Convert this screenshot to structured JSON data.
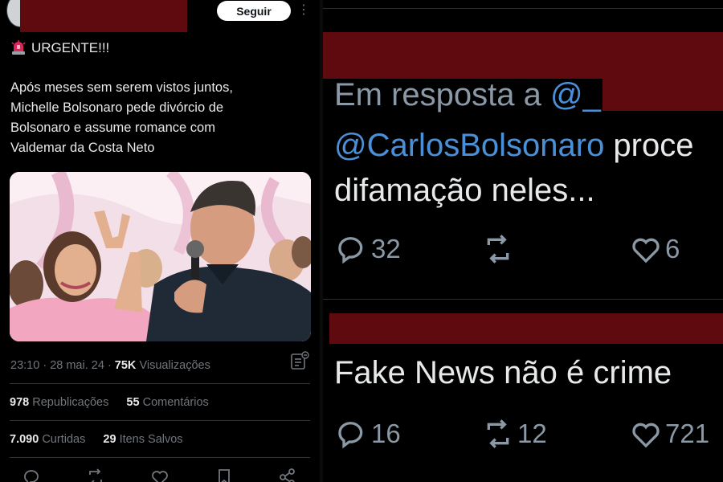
{
  "left_tweet": {
    "follow_label": "Seguir",
    "more_label": "⋮",
    "urgent": "URGENTE!!!",
    "text_lines": [
      "Após meses sem serem vistos juntos,",
      "Michelle Bolsonaro pede divórcio de",
      "Bolsonaro e assume romance com",
      "Valdemar da Costa Neto"
    ],
    "time": "23:10",
    "date": "28 mai. 24",
    "views": "75K",
    "views_label": "Visualizações",
    "reposts": "978",
    "reposts_label": "Republicações",
    "comments": "55",
    "comments_label": "Comentários",
    "likes": "7.090",
    "likes_label": "Curtidas",
    "saves": "29",
    "saves_label": "Itens Salvos"
  },
  "right_top": {
    "reply_prefix": "Em resposta a ",
    "reply_handle": "@_",
    "mention": "@CarlosBolsonaro",
    "text_rest": " proce",
    "text_line2": "difamação neles...",
    "replies": "32",
    "likes": "6"
  },
  "right_bottom": {
    "text": "Fake News não é crime",
    "replies": "16",
    "reposts": "12",
    "likes": "721"
  },
  "colors": {
    "redaction": "#5e0a0e",
    "mention": "#4a90d9",
    "muted": "#71767b"
  }
}
